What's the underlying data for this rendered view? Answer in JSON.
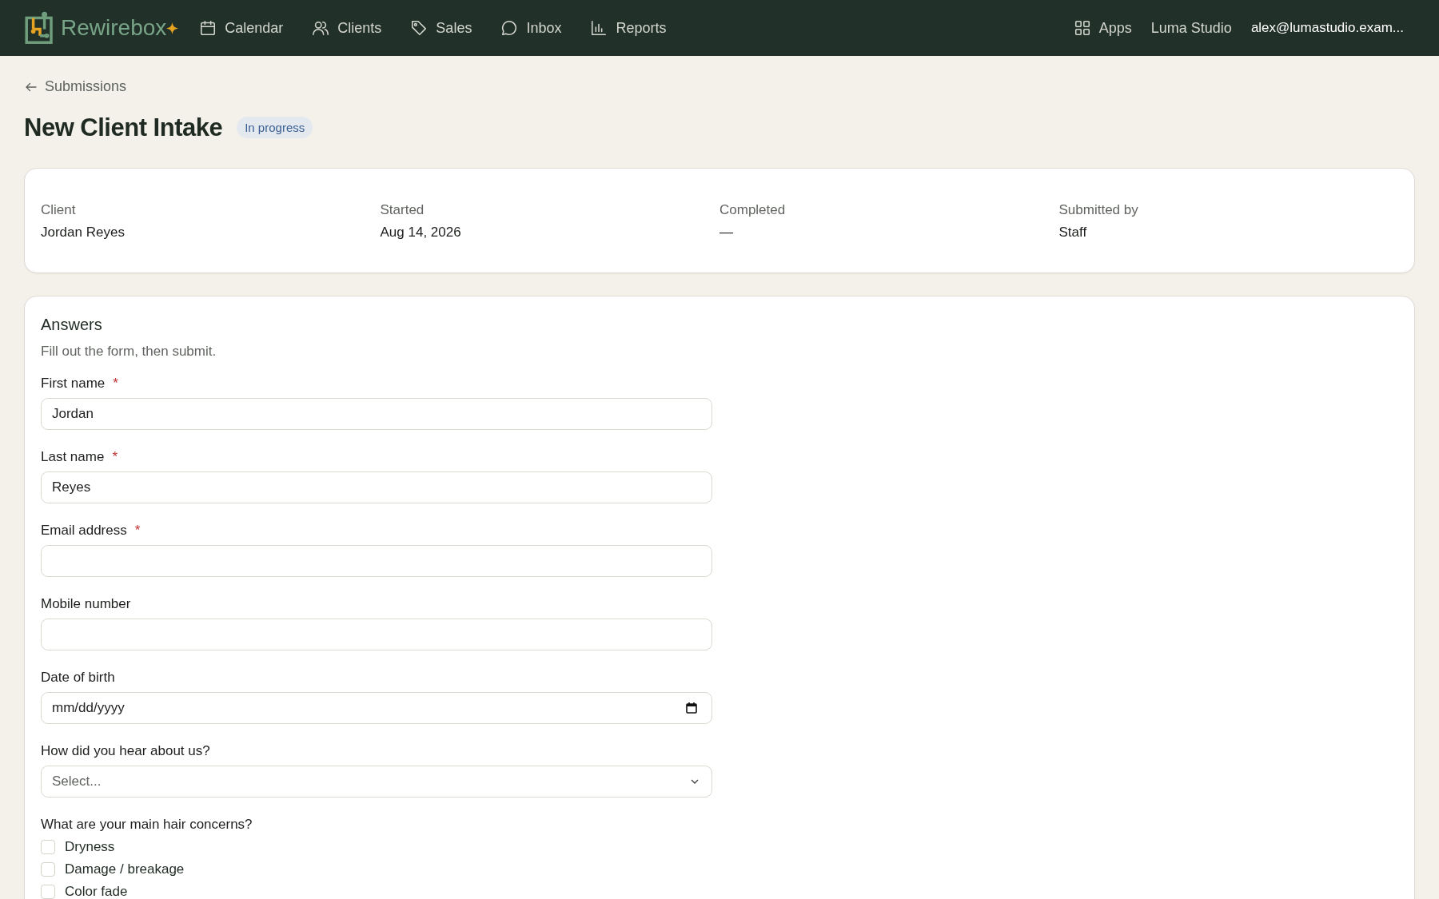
{
  "nav": {
    "brand": "Rewirebox",
    "items": [
      {
        "label": "Calendar"
      },
      {
        "label": "Clients"
      },
      {
        "label": "Sales"
      },
      {
        "label": "Inbox"
      },
      {
        "label": "Reports"
      }
    ],
    "apps": "Apps",
    "workspace": "Luma Studio",
    "account": "alex@lumastudio.exam..."
  },
  "breadcrumb": "Submissions",
  "title": "New Client Intake",
  "status": "In progress",
  "summary": [
    {
      "label": "Client",
      "value": "Jordan Reyes"
    },
    {
      "label": "Started",
      "value": "Aug 14, 2026"
    },
    {
      "label": "Completed",
      "value": "—"
    },
    {
      "label": "Submitted by",
      "value": "Staff"
    }
  ],
  "answers": {
    "title": "Answers",
    "subtitle": "Fill out the form, then submit.",
    "fields": [
      {
        "kind": "text",
        "label": "First name",
        "required_mark": "*",
        "value": "Jordan"
      },
      {
        "kind": "text",
        "label": "Last name",
        "required_mark": "*",
        "value": "Reyes"
      },
      {
        "kind": "text",
        "label": "Email address",
        "required_mark": "*"
      },
      {
        "kind": "text",
        "label": "Mobile number"
      },
      {
        "kind": "date",
        "label": "Date of birth",
        "placeholder": "mm/dd/yyyy"
      },
      {
        "kind": "select",
        "label": "How did you hear about us?",
        "placeholder": "Select..."
      },
      {
        "kind": "checkboxes",
        "label": "What are your main hair concerns?",
        "options": [
          {
            "label": "Dryness",
            "checked": false
          },
          {
            "label": "Damage / breakage",
            "checked": false
          },
          {
            "label": "Color fade",
            "checked": false
          }
        ]
      }
    ]
  }
}
